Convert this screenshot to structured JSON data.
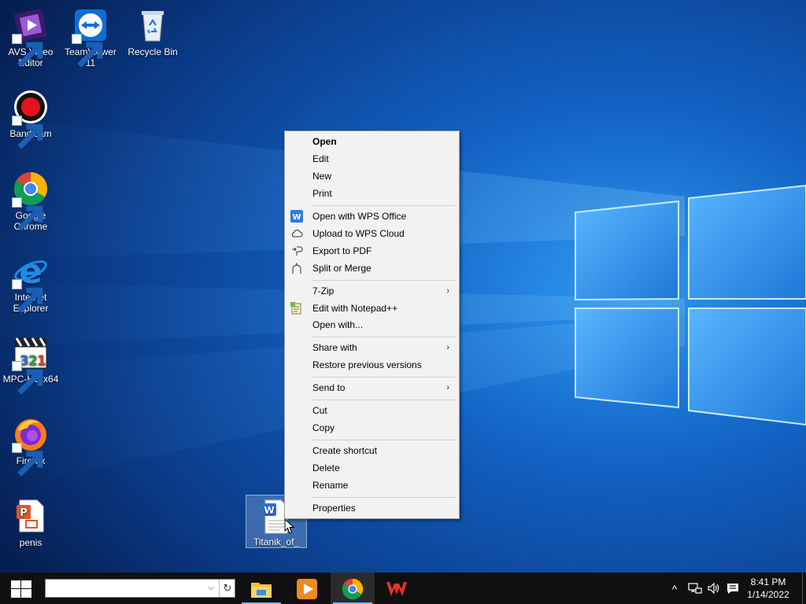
{
  "desktop": {
    "icons": [
      {
        "label": "AVS Video Editor"
      },
      {
        "label": "TeamViewer 11"
      },
      {
        "label": "Recycle Bin"
      },
      {
        "label": "Bandicam"
      },
      {
        "label": "Google Chrome"
      },
      {
        "label": "Internet Explorer"
      },
      {
        "label": "MPC-HC x64"
      },
      {
        "label": "Firefox"
      },
      {
        "label": "penis"
      }
    ],
    "selected_file": {
      "label": "Titanik_of_"
    }
  },
  "context_menu": {
    "items": [
      {
        "label": "Open"
      },
      {
        "label": "Edit"
      },
      {
        "label": "New"
      },
      {
        "label": "Print"
      },
      {
        "label": "Open with WPS Office",
        "icon": "wps-office-icon"
      },
      {
        "label": "Upload to WPS Cloud",
        "icon": "cloud-icon"
      },
      {
        "label": "Export to PDF",
        "icon": "export-pdf-icon"
      },
      {
        "label": "Split or Merge",
        "icon": "split-merge-icon"
      },
      {
        "label": "7-Zip"
      },
      {
        "label": "Edit with Notepad++",
        "icon": "notepad-plus-icon"
      },
      {
        "label": "Open with..."
      },
      {
        "label": "Share with"
      },
      {
        "label": "Restore previous versions"
      },
      {
        "label": "Send to"
      },
      {
        "label": "Cut"
      },
      {
        "label": "Copy"
      },
      {
        "label": "Create shortcut"
      },
      {
        "label": "Delete"
      },
      {
        "label": "Rename"
      },
      {
        "label": "Properties"
      }
    ],
    "submenu_chevron": "›"
  },
  "taskbar": {
    "search_value": "",
    "search_dropdown": "⌵",
    "search_refresh": "↻",
    "apps": [
      "file-explorer-icon",
      "media-player-icon",
      "chrome-icon",
      "wps-office-icon"
    ],
    "tray": {
      "chevron": "^"
    },
    "clock": {
      "time": "8:41 PM",
      "date": "1/14/2022"
    }
  },
  "colors": {
    "menu_bg": "#f2f2f2",
    "taskbar_bg": "#101010",
    "selection": "#6fa0d8"
  }
}
